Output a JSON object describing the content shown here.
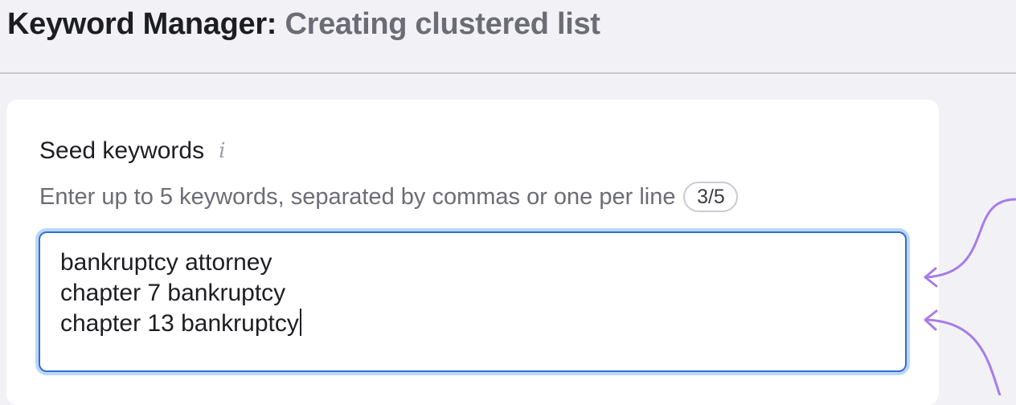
{
  "header": {
    "title_main": "Keyword Manager:",
    "title_sub": "Creating clustered list"
  },
  "seed": {
    "label": "Seed keywords",
    "info_icon": "i",
    "helper": "Enter up to 5 keywords, separated by commas or one per line",
    "counter": "3/5",
    "keywords": [
      "bankruptcy attorney",
      "chapter 7 bankruptcy",
      "chapter 13 bankruptcy"
    ]
  },
  "icons": {
    "info": "info-icon",
    "annotation_arrows": "curved-arrow-icon"
  },
  "colors": {
    "accent": "#2d6fd3",
    "focus_ring": "#bcd6fb",
    "annotation": "#a67ce8",
    "muted_text": "#6b6c75"
  }
}
